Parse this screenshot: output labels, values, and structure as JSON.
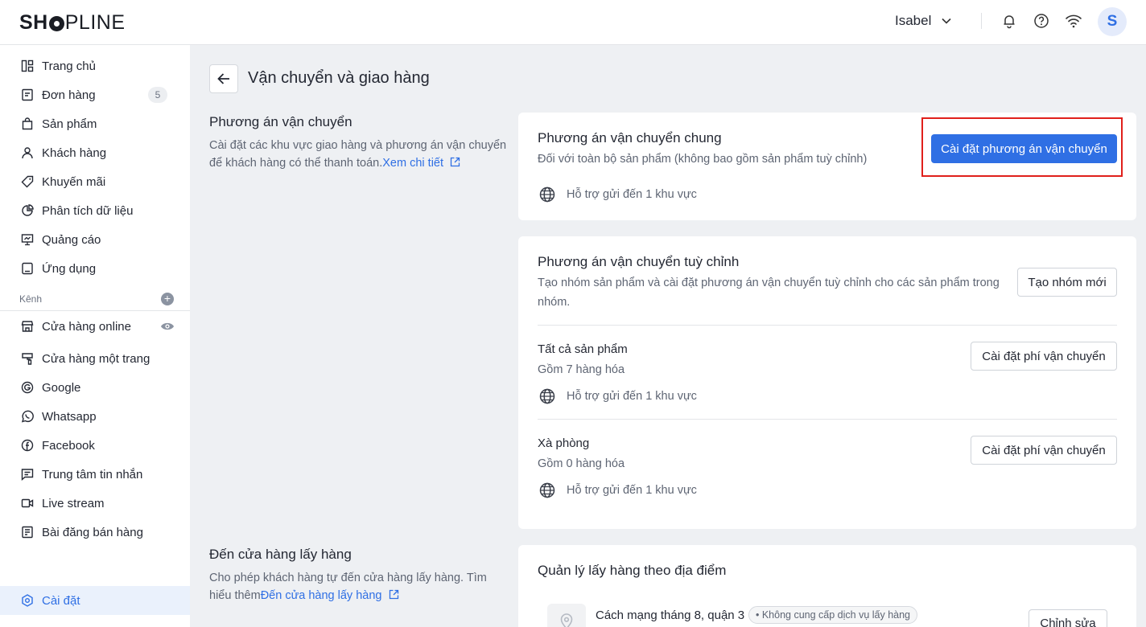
{
  "topbar": {
    "logo_left": "SH",
    "logo_right": "PLINE",
    "user_name": "Isabel",
    "avatar_letter": "S"
  },
  "sidebar": {
    "items": [
      {
        "label": "Trang chủ"
      },
      {
        "label": "Đơn hàng",
        "badge": "5"
      },
      {
        "label": "Sản phẩm"
      },
      {
        "label": "Khách hàng"
      },
      {
        "label": "Khuyến mãi"
      },
      {
        "label": "Phân tích dữ liệu"
      },
      {
        "label": "Quảng cáo"
      },
      {
        "label": "Ứng dụng"
      }
    ],
    "channels_label": "Kênh",
    "channels": [
      {
        "label": "Cửa hàng online"
      },
      {
        "label": "Cửa hàng một trang"
      },
      {
        "label": "Google"
      },
      {
        "label": "Whatsapp"
      },
      {
        "label": "Facebook"
      },
      {
        "label": "Trung tâm tin nhắn"
      },
      {
        "label": "Live stream"
      },
      {
        "label": "Bài đăng bán hàng"
      }
    ],
    "settings_label": "Cài đặt"
  },
  "page": {
    "title": "Vận chuyển và giao hàng"
  },
  "shipping_section": {
    "title": "Phương án vận chuyển",
    "desc": "Cài đặt các khu vực giao hàng và phương án vận chuyển để khách hàng có thể thanh toán.",
    "link": "Xem chi tiết"
  },
  "general_card": {
    "title": "Phương án vận chuyển chung",
    "desc": "Đối với toàn bộ sản phẩm (không bao gồm sản phẩm tuỳ chỉnh)",
    "region": "Hỗ trợ gửi đến 1 khu vực",
    "button": "Cài đặt phương án vận chuyển"
  },
  "custom_card": {
    "title": "Phương án vận chuyển tuỳ chỉnh",
    "desc": "Tạo nhóm sản phẩm và cài đặt phương án vận chuyển tuỳ chỉnh cho các sản phẩm trong nhóm.",
    "new_group_button": "Tạo nhóm mới",
    "groups": [
      {
        "name": "Tất cả sản phẩm",
        "count": "Gồm 7 hàng hóa",
        "region": "Hỗ trợ gửi đến 1 khu vực",
        "button": "Cài đặt phí vận chuyển"
      },
      {
        "name": "Xà phòng",
        "count": "Gồm 0 hàng hóa",
        "region": "Hỗ trợ gửi đến 1 khu vực",
        "button": "Cài đặt phí vận chuyển"
      }
    ]
  },
  "pickup_section": {
    "title": "Đến cửa hàng lấy hàng",
    "desc": "Cho phép khách hàng tự đến cửa hàng lấy hàng. Tìm hiểu thêm",
    "link": "Đến cửa hàng lấy hàng"
  },
  "pickup_card": {
    "title": "Quản lý lấy hàng theo địa điểm",
    "location": "Cách mạng tháng 8, quận 3",
    "tag": "• Không cung cấp dịch vụ lấy hàng",
    "edit_button": "Chỉnh sửa"
  },
  "colors": {
    "primary": "#2f6fe4",
    "highlight": "#e0201b"
  }
}
